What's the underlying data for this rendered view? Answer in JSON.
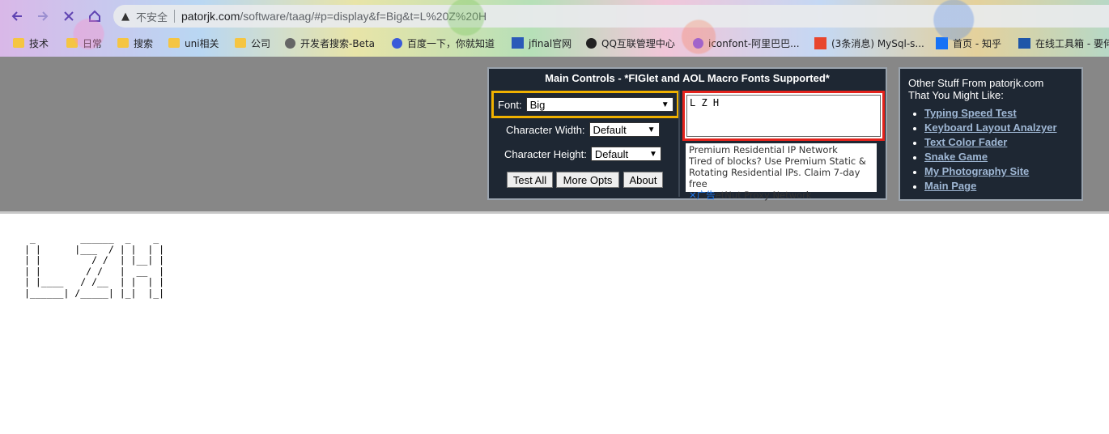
{
  "browser": {
    "insecure_label": "不安全",
    "url_host": "patorjk.com",
    "url_path": "/software/taag/#p=display&f=Big&t=L%20Z%20H",
    "bookmarks": [
      "技术",
      "日常",
      "搜索",
      "uni相关",
      "公司",
      "开发者搜索-Beta",
      "百度一下，你就知道",
      "jfinal官网",
      "QQ互联管理中心",
      "iconfont-阿里巴巴...",
      "(3条消息) MySql-s...",
      "首页 - 知乎",
      "在线工具箱 - 要何"
    ]
  },
  "main_controls": {
    "title": "Main Controls - *FIGlet and AOL Macro Fonts Supported*",
    "font_label": "Font:",
    "font_value": "Big",
    "char_width_label": "Character Width:",
    "char_width_value": "Default",
    "char_height_label": "Character Height:",
    "char_height_value": "Default",
    "test_all": "Test All",
    "more_opts": "More Opts",
    "about": "About",
    "input_text": "L Z H"
  },
  "ad": {
    "line1": "Premium Residential IP Network",
    "line2": "Tired of blocks? Use Premium Static &",
    "line3": "Rotating Residential IPs. Claim 7-day free",
    "tag": "广告",
    "line4": "etNut Proxy Network"
  },
  "side": {
    "heading_line1": "Other Stuff From patorjk.com",
    "heading_line2": "That You Might Like:",
    "links": [
      "Typing Speed Test",
      "Keyboard Layout Analzyer",
      "Text Color Fader",
      "Snake Game",
      "My Photography Site",
      "Main Page"
    ]
  },
  "output": {
    "ascii": " _        ______  _    _ \n| |      |___  / | |  | |\n| |         / /  | |__| |\n| |        / /   |  __  |\n| |____   / /__  | |  | |\n|______| /_____| |_|  |_|"
  }
}
